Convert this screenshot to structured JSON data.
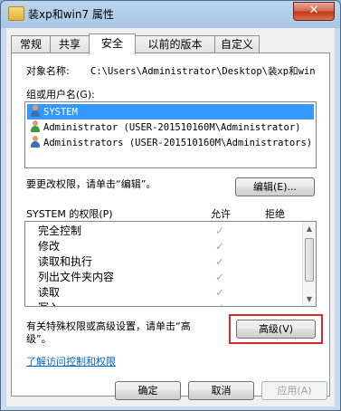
{
  "window": {
    "title": "装xp和win7 属性",
    "close_label": "✕"
  },
  "tabs": [
    {
      "label": "常规",
      "active": false
    },
    {
      "label": "共享",
      "active": false
    },
    {
      "label": "安全",
      "active": true
    },
    {
      "label": "以前的版本",
      "active": false
    },
    {
      "label": "自定义",
      "active": false
    }
  ],
  "security": {
    "object_name_label": "对象名称:",
    "object_name_value": "C:\\Users\\Administrator\\Desktop\\装xp和win",
    "groups_label": "组或用户名(G):",
    "groups": [
      {
        "name": "SYSTEM",
        "selected": true,
        "icon": "group-user-icon"
      },
      {
        "name": "Administrator (USER-201510160M\\Administrator)",
        "selected": false,
        "icon": "user-icon"
      },
      {
        "name": "Administrators (USER-201510160M\\Administrators)",
        "selected": false,
        "icon": "group-user-icon"
      }
    ],
    "change_hint": "要更改权限，请单击“编辑”。",
    "edit_button": "编辑(E)...",
    "perm_title": "SYSTEM 的权限(P)",
    "allow_header": "允许",
    "deny_header": "拒绝",
    "permissions": [
      {
        "name": "完全控制",
        "allow": true,
        "deny": false
      },
      {
        "name": "修改",
        "allow": true,
        "deny": false
      },
      {
        "name": "读取和执行",
        "allow": true,
        "deny": false
      },
      {
        "name": "列出文件夹内容",
        "allow": true,
        "deny": false
      },
      {
        "name": "读取",
        "allow": true,
        "deny": false
      },
      {
        "name": "写入",
        "allow": true,
        "deny": false
      }
    ],
    "advanced_hint_line1": "有关特殊权限或高级设置，请单击“高",
    "advanced_hint_line2": "级”。",
    "advanced_button": "高级(V)",
    "learn_link": "了解访问控制和权限"
  },
  "footer": {
    "ok": "确定",
    "cancel": "取消",
    "apply": "应用(A)"
  }
}
